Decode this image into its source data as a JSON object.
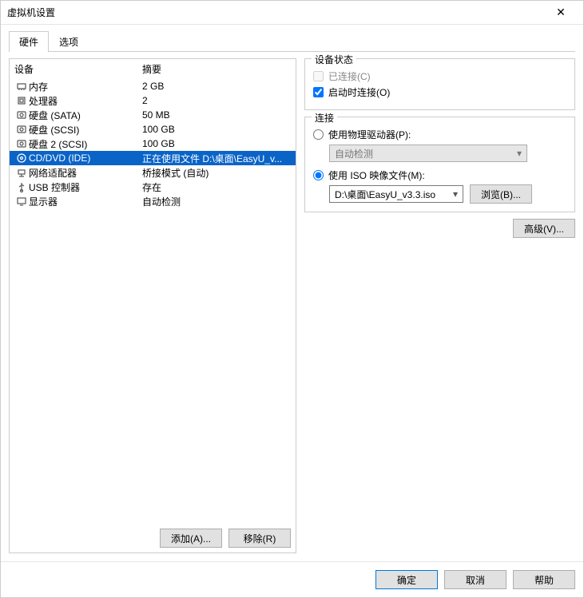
{
  "window": {
    "title": "虚拟机设置"
  },
  "tabs": {
    "hardware": "硬件",
    "options": "选项"
  },
  "headers": {
    "device": "设备",
    "summary": "摘要"
  },
  "devices": [
    {
      "icon": "memory",
      "name": "内存",
      "summary": "2 GB",
      "selected": false
    },
    {
      "icon": "cpu",
      "name": "处理器",
      "summary": "2",
      "selected": false
    },
    {
      "icon": "disk",
      "name": "硬盘 (SATA)",
      "summary": "50 MB",
      "selected": false
    },
    {
      "icon": "disk",
      "name": "硬盘 (SCSI)",
      "summary": "100 GB",
      "selected": false
    },
    {
      "icon": "disk",
      "name": "硬盘 2 (SCSI)",
      "summary": "100 GB",
      "selected": false
    },
    {
      "icon": "cd",
      "name": "CD/DVD (IDE)",
      "summary": "正在使用文件 D:\\桌面\\EasyU_v...",
      "selected": true
    },
    {
      "icon": "net",
      "name": "网络适配器",
      "summary": "桥接模式 (自动)",
      "selected": false
    },
    {
      "icon": "usb",
      "name": "USB 控制器",
      "summary": "存在",
      "selected": false
    },
    {
      "icon": "display",
      "name": "显示器",
      "summary": "自动检测",
      "selected": false
    }
  ],
  "leftButtons": {
    "add": "添加(A)...",
    "remove": "移除(R)"
  },
  "status": {
    "legend": "设备状态",
    "connected": "已连接(C)",
    "connectAtPowerOn": "启动时连接(O)"
  },
  "connection": {
    "legend": "连接",
    "physical": "使用物理驱动器(P):",
    "physicalValue": "自动检测",
    "iso": "使用 ISO 映像文件(M):",
    "isoValue": "D:\\桌面\\EasyU_v3.3.iso",
    "browse": "浏览(B)..."
  },
  "advanced": "高级(V)...",
  "footer": {
    "ok": "确定",
    "cancel": "取消",
    "help": "帮助"
  }
}
